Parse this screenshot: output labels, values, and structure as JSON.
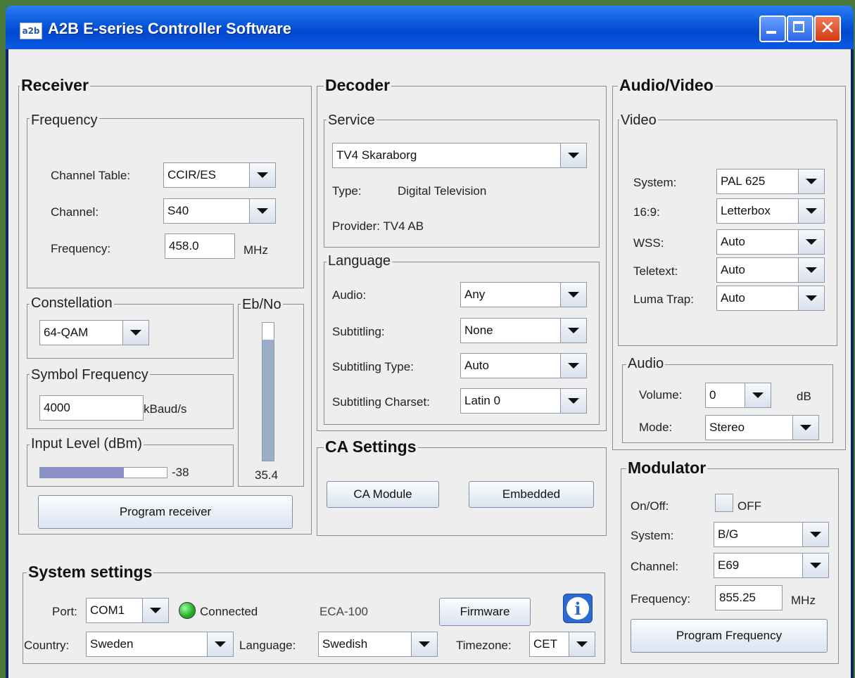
{
  "window": {
    "title": "A2B E-series Controller Software",
    "icon_text": "a2b"
  },
  "receiver": {
    "title": "Receiver",
    "frequency_group": "Frequency",
    "channel_table_label": "Channel Table:",
    "channel_table_value": "CCIR/ES",
    "channel_label": "Channel:",
    "channel_value": "S40",
    "frequency_label": "Frequency:",
    "frequency_value": "458.0",
    "frequency_unit": "MHz",
    "constellation_group": "Constellation",
    "constellation_value": "64-QAM",
    "symbol_group": "Symbol Frequency",
    "symbol_value": "4000",
    "symbol_unit": "kBaud/s",
    "input_level_group": "Input Level (dBm)",
    "input_level_value": "-38",
    "input_level_fill": 0.66,
    "ebno_group": "Eb/No",
    "ebno_value": "35.4",
    "ebno_fill": 0.88,
    "program_button": "Program receiver"
  },
  "decoder": {
    "title": "Decoder",
    "service_group": "Service",
    "service_value": "TV4 Skaraborg",
    "type_label": "Type:",
    "type_value": "Digital Television",
    "provider_text": "Provider: TV4 AB",
    "language_group": "Language",
    "audio_label": "Audio:",
    "audio_value": "Any",
    "subtitling_label": "Subtitling:",
    "subtitling_value": "None",
    "subtitling_type_label": "Subtitling Type:",
    "subtitling_type_value": "Auto",
    "subtitling_charset_label": "Subtitling Charset:",
    "subtitling_charset_value": "Latin 0"
  },
  "ca_settings": {
    "title": "CA Settings",
    "ca_module_button": "CA Module",
    "embedded_button": "Embedded"
  },
  "audio_video": {
    "title": "Audio/Video",
    "video_group": "Video",
    "system_label": "System:",
    "system_value": "PAL 625",
    "aspect_label": "16:9:",
    "aspect_value": "Letterbox",
    "wss_label": "WSS:",
    "wss_value": "Auto",
    "teletext_label": "Teletext:",
    "teletext_value": "Auto",
    "luma_label": "Luma Trap:",
    "luma_value": "Auto",
    "audio_group": "Audio",
    "volume_label": "Volume:",
    "volume_value": "0",
    "volume_unit": "dB",
    "mode_label": "Mode:",
    "mode_value": "Stereo"
  },
  "modulator": {
    "title": "Modulator",
    "onoff_label": "On/Off:",
    "onoff_value": "OFF",
    "system_label": "System:",
    "system_value": "B/G",
    "channel_label": "Channel:",
    "channel_value": "E69",
    "frequency_label": "Frequency:",
    "frequency_value": "855.25",
    "frequency_unit": "MHz",
    "program_button": "Program Frequency"
  },
  "system_settings": {
    "title": "System settings",
    "port_label": "Port:",
    "port_value": "COM1",
    "status_text": "Connected",
    "status_color": "#22aa22",
    "device_model": "ECA-100",
    "firmware_button": "Firmware",
    "country_label": "Country:",
    "country_value": "Sweden",
    "language_label": "Language:",
    "language_value": "Swedish",
    "timezone_label": "Timezone:",
    "timezone_value": "CET"
  }
}
